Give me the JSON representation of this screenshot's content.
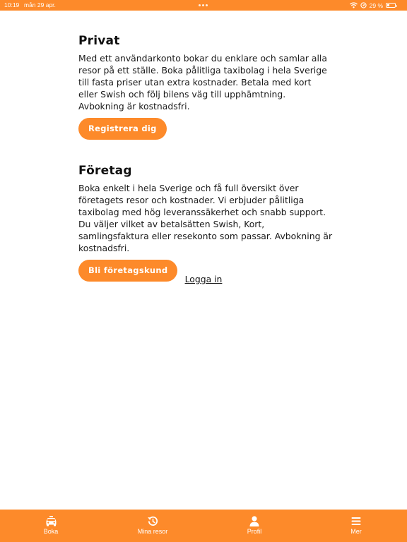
{
  "status_bar": {
    "time": "10:19",
    "date": "mån 29 apr.",
    "battery": "29 %",
    "battery_level": 0.29
  },
  "sections": {
    "privat": {
      "title": "Privat",
      "body": "Med ett användarkonto bokar du enklare och samlar alla resor på ett ställe. Boka pålitliga taxibolag i hela Sverige till fasta priser utan extra kostnader. Betala med kort eller Swish och följ bilens väg till upphämtning. Avbokning är kostnadsfri.",
      "button_label": "Registrera dig"
    },
    "foretag": {
      "title": "Företag",
      "body": "Boka enkelt i hela Sverige och få full översikt över företagets resor och kostnader. Vi erbjuder pålitliga taxibolag med hög leveranssäkerhet och snabb support. Du väljer vilket av betalsätten Swish, Kort, samlingsfaktura eller resekonto som passar. Avbokning är kostnadsfri.",
      "button_label": "Bli företagskund"
    }
  },
  "login_link": "Logga in",
  "tab_bar": {
    "items": [
      {
        "label": "Boka",
        "icon": "taxi-car-icon"
      },
      {
        "label": "Mina resor",
        "icon": "history-icon"
      },
      {
        "label": "Profil",
        "icon": "person-icon"
      },
      {
        "label": "Mer",
        "icon": "menu-icon"
      }
    ]
  },
  "colors": {
    "accent": "#fd8a2a",
    "text": "#111111",
    "background": "#ffffff"
  }
}
